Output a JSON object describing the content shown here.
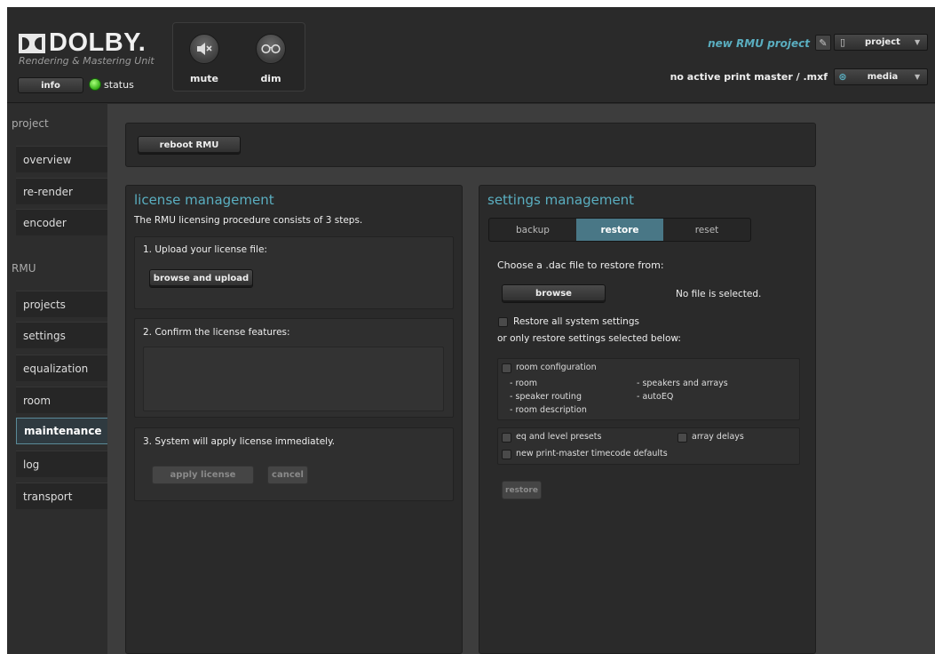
{
  "header": {
    "logo_text": "DOLBY.",
    "subtitle": "Rendering & Mastering Unit",
    "info_label": "info",
    "status_label": "status",
    "mute_label": "mute",
    "dim_label": "dim",
    "project_title": "new RMU project",
    "project_select": "project",
    "print_master": "no active print master / .mxf",
    "media_select": "media",
    "status_color": "#3bb31c",
    "accent_color": "#5aaec0"
  },
  "sidebar": {
    "project_section": "project",
    "rmu_section": "RMU",
    "project_items": [
      "overview",
      "re-render",
      "encoder"
    ],
    "rmu_items": [
      "projects",
      "settings",
      "equalization",
      "room",
      "maintenance",
      "log",
      "transport"
    ],
    "active": "maintenance"
  },
  "main": {
    "reboot_label": "reboot RMU",
    "license": {
      "title": "license management",
      "intro": "The RMU licensing procedure consists of 3 steps.",
      "step1": "1. Upload your license file:",
      "browse_upload": "browse and upload",
      "step2": "2. Confirm the license features:",
      "step3": "3. System will apply license immediately.",
      "apply": "apply license",
      "cancel": "cancel"
    },
    "settings": {
      "title": "settings management",
      "tabs": [
        "backup",
        "restore",
        "reset"
      ],
      "active_tab": "restore",
      "choose_text": "Choose a .dac file to restore from:",
      "browse": "browse",
      "no_file": "No file is selected.",
      "restore_all": "Restore all system settings",
      "or_only": "or only restore settings selected below:",
      "room_config": "room configuration",
      "room": "- room",
      "speaker_routing": "- speaker routing",
      "room_description": "- room description",
      "speakers_arrays": "- speakers and arrays",
      "autoeq": "- autoEQ",
      "eq_presets": "eq and level presets",
      "array_delays": "array delays",
      "timecode_defaults": "new print-master timecode defaults",
      "restore_button": "restore"
    }
  }
}
